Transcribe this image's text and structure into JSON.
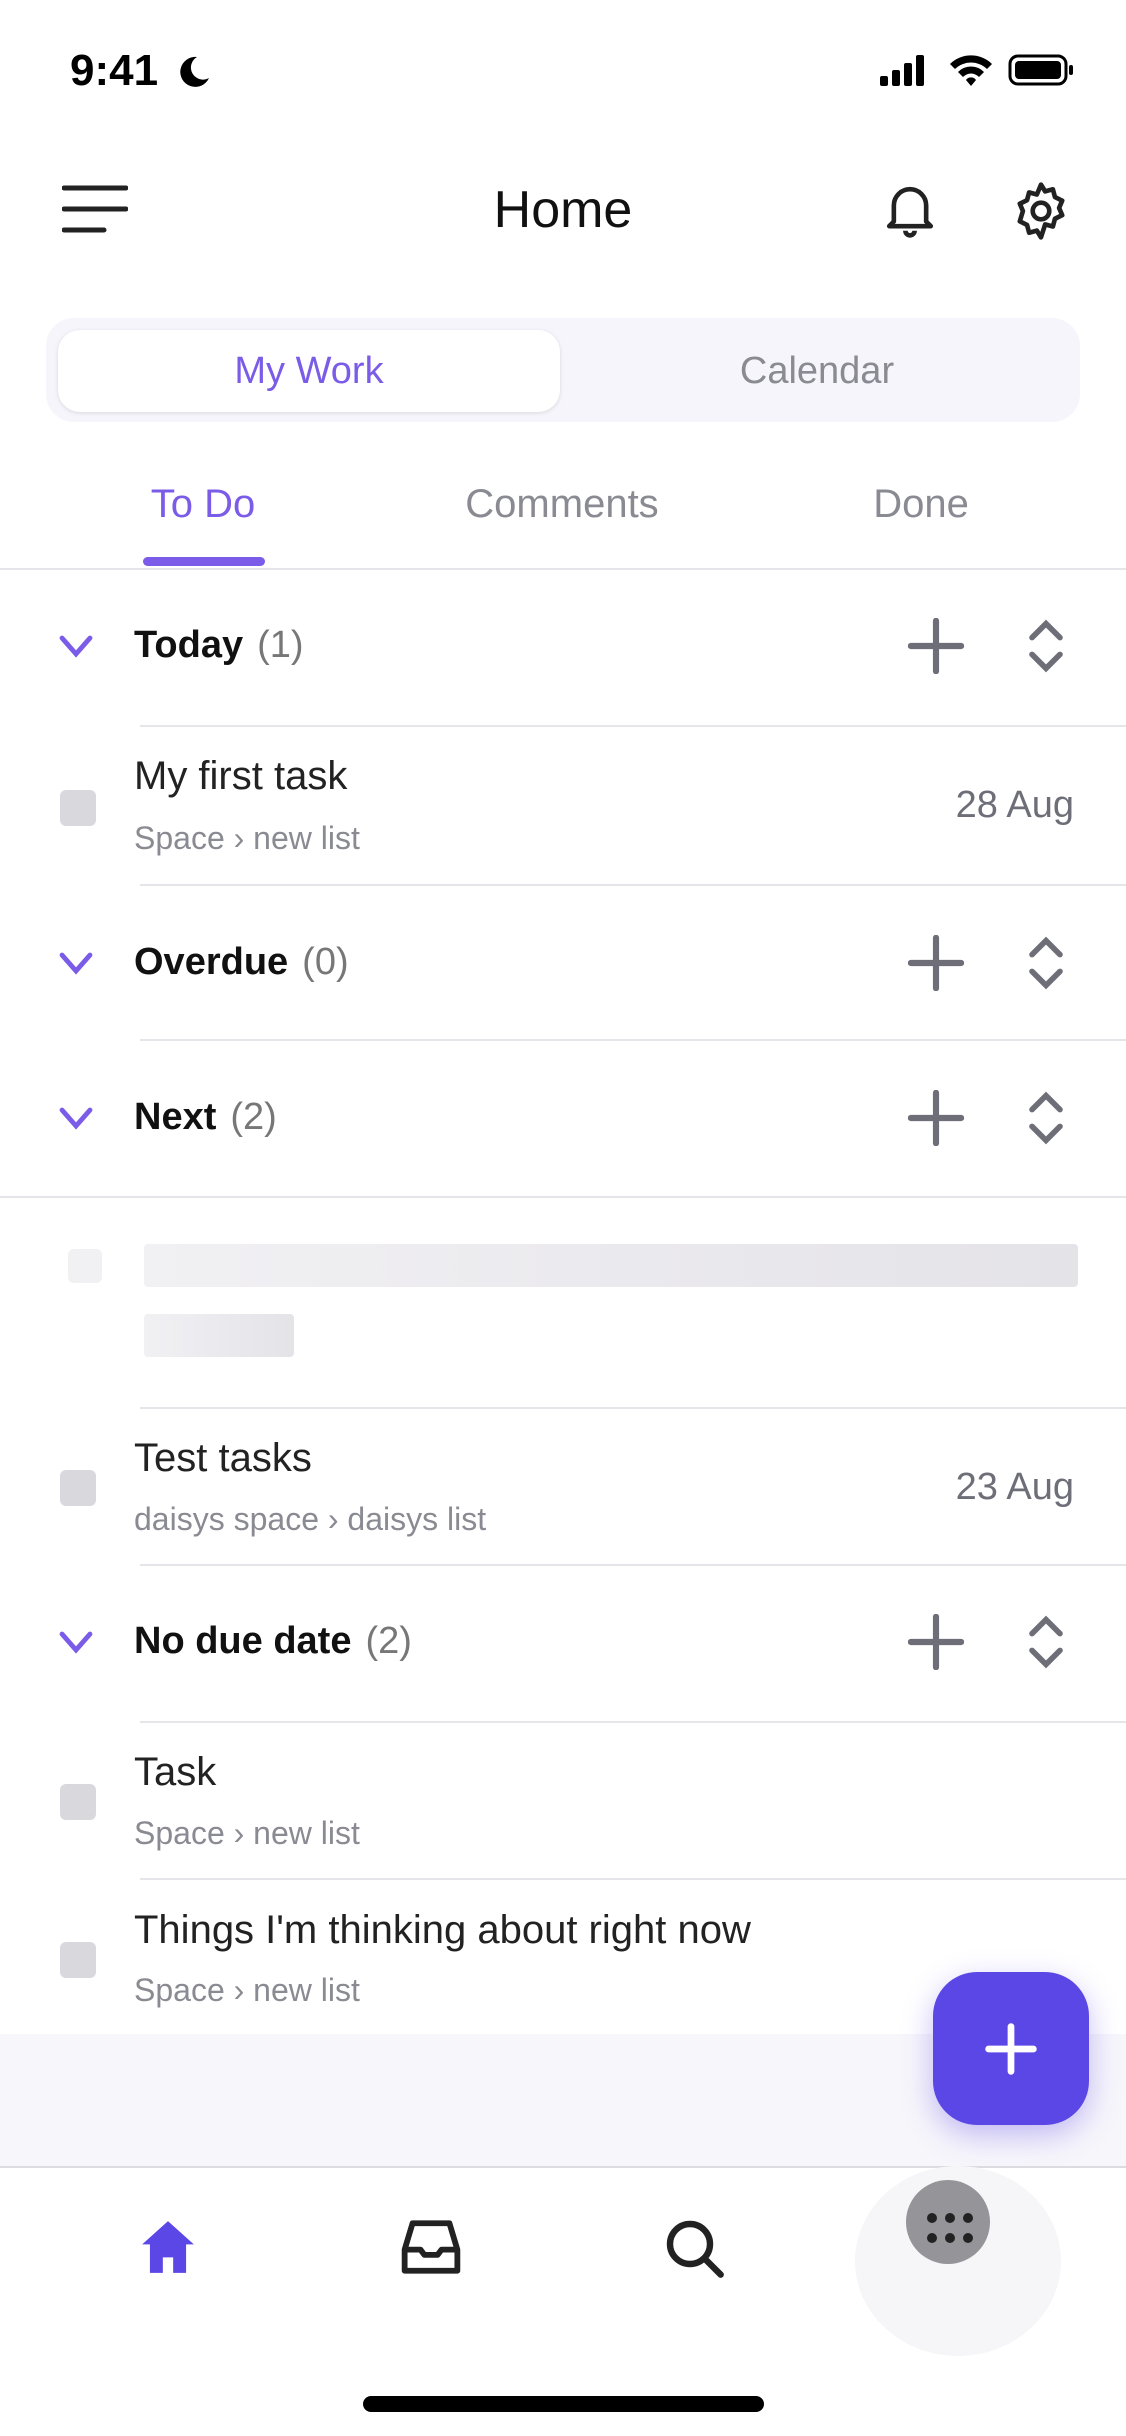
{
  "status_bar": {
    "time": "9:41"
  },
  "header": {
    "title": "Home"
  },
  "segments": {
    "active": "My Work",
    "inactive": "Calendar"
  },
  "tabs": [
    {
      "label": "To Do",
      "active": true
    },
    {
      "label": "Comments"
    },
    {
      "label": "Done"
    }
  ],
  "sections": [
    {
      "title": "Today",
      "count": "(1)",
      "tasks": [
        {
          "title": "My first task",
          "space": "Space",
          "list": "new list",
          "date": "28 Aug"
        }
      ]
    },
    {
      "title": "Overdue",
      "count": "(0)",
      "tasks": []
    },
    {
      "title": "Next",
      "count": "(2)",
      "tasks": [
        {
          "title": "Test tasks",
          "space": "daisys space",
          "list": "daisys list",
          "date": "23 Aug"
        }
      ]
    },
    {
      "title": "No due date",
      "count": "(2)",
      "tasks": [
        {
          "title": "Task",
          "space": "Space",
          "list": "new list"
        },
        {
          "title": "Things I'm thinking about right now",
          "space": "Space",
          "list": "new list"
        }
      ]
    }
  ],
  "colors": {
    "accent": "#7b5ce8",
    "fab": "#5b46e6"
  },
  "bottom_nav": [
    "home-icon",
    "inbox-icon",
    "search-icon",
    "apps-icon"
  ]
}
